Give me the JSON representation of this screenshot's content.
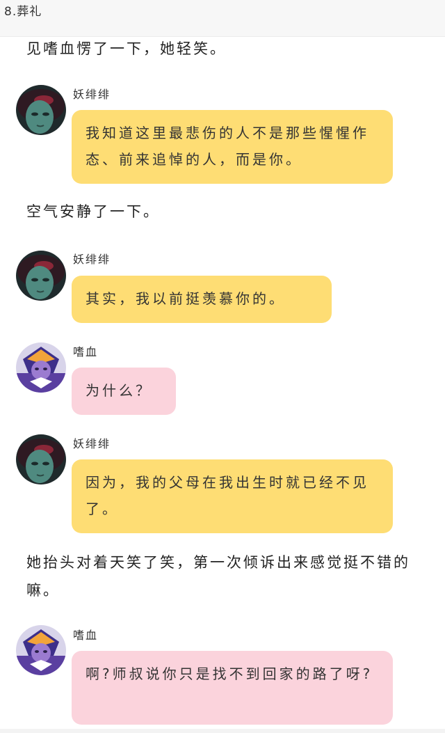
{
  "header": {
    "title": "8.葬礼"
  },
  "narration": {
    "line1": "见嗜血愣了一下，她轻笑。",
    "line2": "空气安静了一下。",
    "line3": "她抬头对着天笑了笑，第一次倾诉出来感觉挺不错的嘛。"
  },
  "messages": [
    {
      "speaker": "妖绯绯",
      "text": "我知道这里最悲伤的人不是那些惺惺作态、前来追悼的人，而是你。",
      "avatar": "green-face-avatar-icon",
      "bubble_color": "#fedd74"
    },
    {
      "speaker": "妖绯绯",
      "text": "其实，我以前挺羡慕你的。",
      "avatar": "green-face-avatar-icon",
      "bubble_color": "#fedd74"
    },
    {
      "speaker": "嗜血",
      "text": "为什么？",
      "avatar": "purple-helmet-avatar-icon",
      "bubble_color": "#fbd3dc"
    },
    {
      "speaker": "妖绯绯",
      "text": "因为，我的父母在我出生时就已经不见了。",
      "avatar": "green-face-avatar-icon",
      "bubble_color": "#fedd74"
    },
    {
      "speaker": "嗜血",
      "text": "啊?师叔说你只是找不到回家的路了呀?",
      "avatar": "purple-helmet-avatar-icon",
      "bubble_color": "#fbd3dc"
    }
  ]
}
